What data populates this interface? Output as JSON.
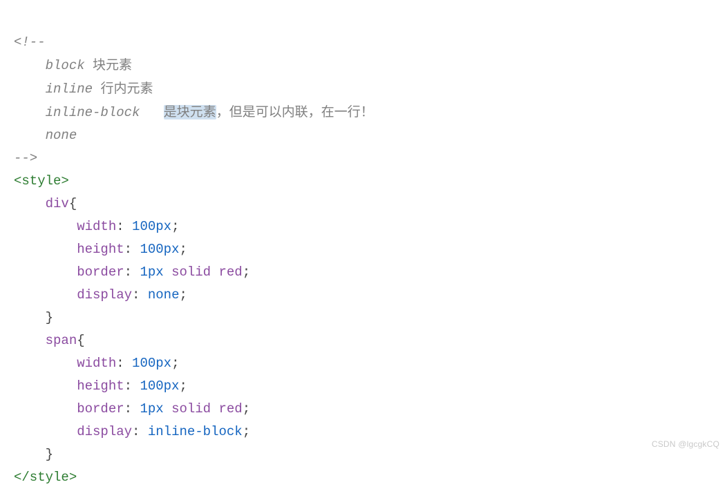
{
  "comment": {
    "open": "<!--",
    "l1_key": "block",
    "l1_note": "块元素",
    "l2_key": "inline",
    "l2_note": "行内元素",
    "l3_key": "inline-block",
    "l3_note_hl": "是块元素",
    "l3_note_rest": "，但是可以内联，在一行！",
    "l4_key": "none",
    "close": "-->"
  },
  "style": {
    "open": "<style>",
    "close": "</style>",
    "div": {
      "selector": "div",
      "rules": [
        {
          "prop": "width",
          "value": "100px"
        },
        {
          "prop": "height",
          "value": "100px"
        },
        {
          "prop": "border",
          "value_num": "1px",
          "value_kw1": "solid",
          "value_kw2": "red"
        },
        {
          "prop": "display",
          "value_kw": "none"
        }
      ]
    },
    "span": {
      "selector": "span",
      "rules": [
        {
          "prop": "width",
          "value": "100px"
        },
        {
          "prop": "height",
          "value": "100px"
        },
        {
          "prop": "border",
          "value_num": "1px",
          "value_kw1": "solid",
          "value_kw2": "red"
        },
        {
          "prop": "display",
          "value_kw": "inline-block"
        }
      ]
    }
  },
  "watermark": "CSDN @lgcgkCQ"
}
